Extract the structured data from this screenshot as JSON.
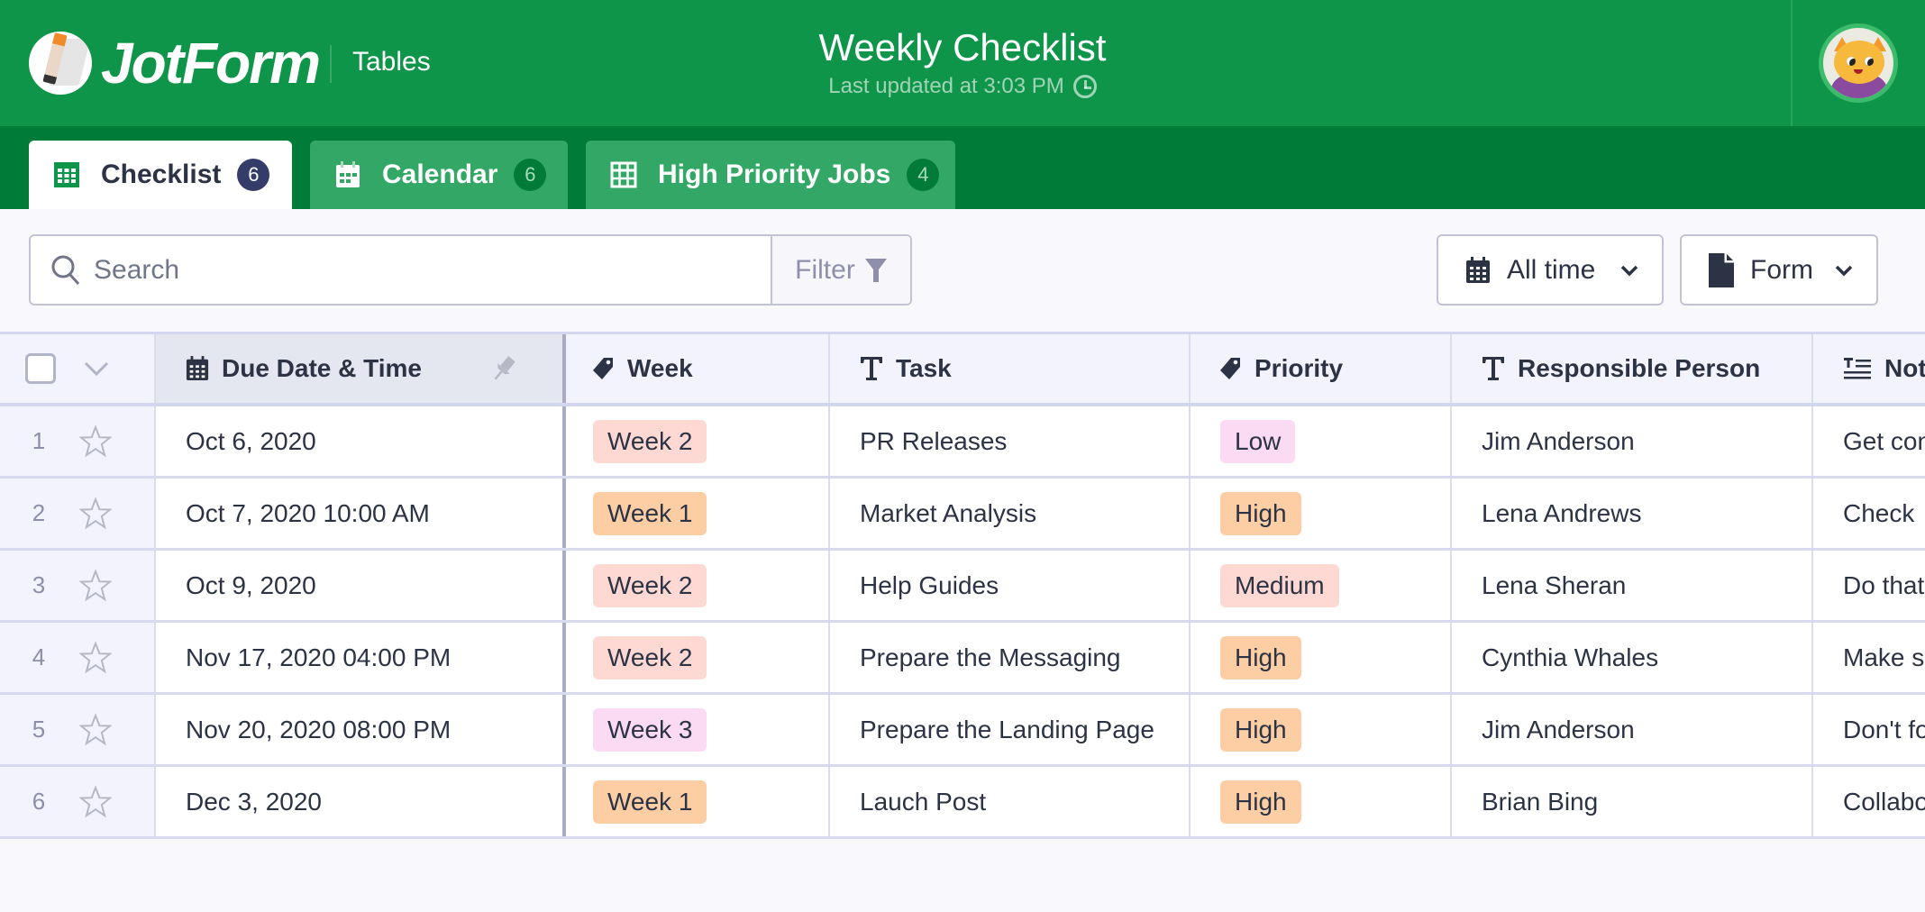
{
  "header": {
    "brand": "JotForm",
    "app_name": "Tables",
    "title": "Weekly Checklist",
    "last_updated": "Last updated at 3:03 PM",
    "colors": {
      "header_bg": "#0f9549",
      "tabbar_bg": "#017c38"
    }
  },
  "tabs": [
    {
      "label": "Checklist",
      "count": "6",
      "icon": "table-grid-icon",
      "active": true
    },
    {
      "label": "Calendar",
      "count": "6",
      "icon": "calendar-icon",
      "active": false
    },
    {
      "label": "High Priority Jobs",
      "count": "4",
      "icon": "table-grid-icon",
      "active": false
    }
  ],
  "toolbar": {
    "search_placeholder": "Search",
    "filter_label": "Filter",
    "time_dropdown": "All time",
    "form_dropdown": "Form"
  },
  "table": {
    "columns": [
      {
        "label": "Due Date & Time",
        "icon": "calendar-icon"
      },
      {
        "label": "Week",
        "icon": "tag-icon"
      },
      {
        "label": "Task",
        "icon": "text-icon"
      },
      {
        "label": "Priority",
        "icon": "tag-icon"
      },
      {
        "label": "Responsible Person",
        "icon": "text-icon"
      },
      {
        "label": "Notes",
        "icon": "long-text-icon"
      }
    ],
    "rows": [
      {
        "num": "1",
        "due": "Oct 6, 2020",
        "week": "Week 2",
        "task": "PR Releases",
        "priority": "Low",
        "person": "Jim Anderson",
        "notes": "Get con"
      },
      {
        "num": "2",
        "due": "Oct 7, 2020 10:00 AM",
        "week": "Week 1",
        "task": "Market Analysis",
        "priority": "High",
        "person": "Lena Andrews",
        "notes": "Check"
      },
      {
        "num": "3",
        "due": "Oct 9, 2020",
        "week": "Week 2",
        "task": "Help Guides",
        "priority": "Medium",
        "person": "Lena Sheran",
        "notes": "Do that"
      },
      {
        "num": "4",
        "due": "Nov 17, 2020 04:00 PM",
        "week": "Week 2",
        "task": "Prepare the Messaging",
        "priority": "High",
        "person": "Cynthia Whales",
        "notes": "Make s"
      },
      {
        "num": "5",
        "due": "Nov 20, 2020 08:00 PM",
        "week": "Week 3",
        "task": "Prepare the Landing Page",
        "priority": "High",
        "person": "Jim Anderson",
        "notes": "Don't fo"
      },
      {
        "num": "6",
        "due": "Dec 3, 2020",
        "week": "Week 1",
        "task": "Lauch Post",
        "priority": "High",
        "person": "Brian Bing",
        "notes": "Collabo"
      }
    ],
    "badge_colors": {
      "Week 1": "#fdcea3",
      "Week 2": "#fed9d3",
      "Week 3": "#fbdaf3",
      "Low": "#fbdaf3",
      "Medium": "#fed9d3",
      "High": "#fdcea3"
    }
  }
}
